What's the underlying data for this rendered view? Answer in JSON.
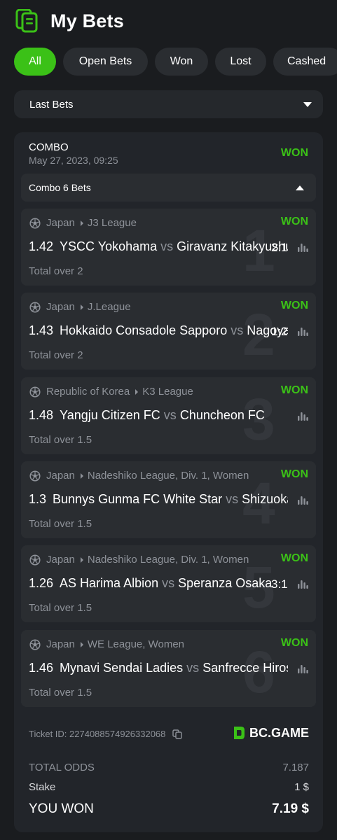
{
  "header": {
    "title": "My Bets",
    "icon": "receipt-icon"
  },
  "tabs": [
    {
      "label": "All",
      "active": true
    },
    {
      "label": "Open Bets",
      "active": false
    },
    {
      "label": "Won",
      "active": false
    },
    {
      "label": "Lost",
      "active": false
    },
    {
      "label": "Cashed",
      "active": false
    }
  ],
  "filter": {
    "label": "Last Bets"
  },
  "combo": {
    "type": "COMBO",
    "date": "May 27, 2023, 09:25",
    "status": "WON",
    "toggle_label": "Combo 6 Bets"
  },
  "bets": [
    {
      "num": "1",
      "country": "Japan",
      "league": "J3 League",
      "status": "WON",
      "odds": "1.42",
      "home": "YSCC Yokohama",
      "vs": "vs",
      "away": "Giravanz Kitakyushu",
      "score": "2:1",
      "market": "Total over 2"
    },
    {
      "num": "2",
      "country": "Japan",
      "league": "J.League",
      "status": "WON",
      "odds": "1.43",
      "home": "Hokkaido Consadole Sapporo",
      "vs": "vs",
      "away": "Nagoya Grampus",
      "score": "1:2",
      "market": "Total over 2"
    },
    {
      "num": "3",
      "country": "Republic of Korea",
      "league": "K3 League",
      "status": "WON",
      "odds": "1.48",
      "home": "Yangju Citizen FC",
      "vs": "vs",
      "away": "Chuncheon FC",
      "score": "",
      "market": "Total over 1.5"
    },
    {
      "num": "4",
      "country": "Japan",
      "league": "Nadeshiko League, Div. 1, Women",
      "status": "WON",
      "odds": "1.3",
      "home": "Bunnys Gunma FC White Star",
      "vs": "vs",
      "away": "Shizuoka",
      "score": "",
      "market": "Total over 1.5"
    },
    {
      "num": "5",
      "country": "Japan",
      "league": "Nadeshiko League, Div. 1, Women",
      "status": "WON",
      "odds": "1.26",
      "home": "AS Harima Albion",
      "vs": "vs",
      "away": "Speranza Osaka",
      "score": "3:1",
      "market": "Total over 1.5"
    },
    {
      "num": "6",
      "country": "Japan",
      "league": "WE League, Women",
      "status": "WON",
      "odds": "1.46",
      "home": "Mynavi Sendai Ladies",
      "vs": "vs",
      "away": "Sanfrecce Hiroshima",
      "score": "",
      "market": "Total over 1.5"
    }
  ],
  "ticket": {
    "label": "Ticket ID: 2274088574926332068",
    "brand": "BC.GAME"
  },
  "totals": {
    "odds_label": "TOTAL ODDS",
    "odds_value": "7.187",
    "stake_label": "Stake",
    "stake_value": "1 $",
    "won_label": "YOU WON",
    "won_value": "7.19 $"
  },
  "colors": {
    "accent": "#3bc117",
    "background": "#1a1c1f",
    "card": "#22252a",
    "muted": "#8e9299"
  }
}
